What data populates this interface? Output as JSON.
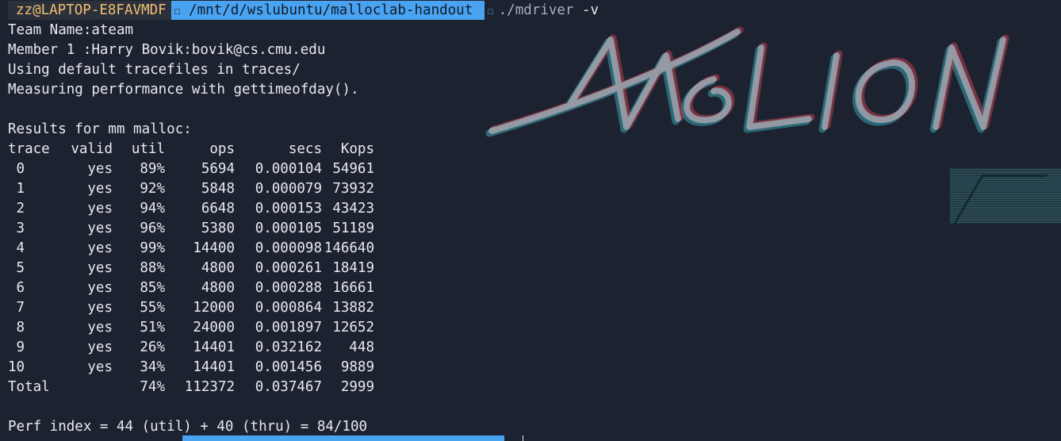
{
  "prompt": {
    "user_host": "zz@LAPTOP-E8FAVMDF",
    "path_glyph": "☐",
    "path": "/mnt/d/wslubuntu/malloclab-handout",
    "sep_glyph": "☐",
    "command": "./mdriver",
    "argument": "-v"
  },
  "header_lines": [
    "Team Name:ateam",
    "Member 1 :Harry Bovik:bovik@cs.cmu.edu",
    "Using default tracefiles in traces/",
    "Measuring performance with gettimeofday().",
    "",
    "Results for mm malloc:"
  ],
  "table": {
    "columns": [
      "trace",
      "valid",
      "util",
      "ops",
      "secs",
      "Kops"
    ],
    "rows": [
      {
        "trace": " 0",
        "valid": "yes",
        "util": "89%",
        "ops": "5694",
        "secs": "0.000104",
        "kops": "54961"
      },
      {
        "trace": " 1",
        "valid": "yes",
        "util": "92%",
        "ops": "5848",
        "secs": "0.000079",
        "kops": "73932"
      },
      {
        "trace": " 2",
        "valid": "yes",
        "util": "94%",
        "ops": "6648",
        "secs": "0.000153",
        "kops": "43423"
      },
      {
        "trace": " 3",
        "valid": "yes",
        "util": "96%",
        "ops": "5380",
        "secs": "0.000105",
        "kops": "51189"
      },
      {
        "trace": " 4",
        "valid": "yes",
        "util": "99%",
        "ops": "14400",
        "secs": "0.000098",
        "kops": "146640"
      },
      {
        "trace": " 5",
        "valid": "yes",
        "util": "88%",
        "ops": "4800",
        "secs": "0.000261",
        "kops": "18419"
      },
      {
        "trace": " 6",
        "valid": "yes",
        "util": "85%",
        "ops": "4800",
        "secs": "0.000288",
        "kops": "16661"
      },
      {
        "trace": " 7",
        "valid": "yes",
        "util": "55%",
        "ops": "12000",
        "secs": "0.000864",
        "kops": "13882"
      },
      {
        "trace": " 8",
        "valid": "yes",
        "util": "51%",
        "ops": "24000",
        "secs": "0.001897",
        "kops": "12652"
      },
      {
        "trace": " 9",
        "valid": "yes",
        "util": "26%",
        "ops": "14401",
        "secs": "0.032162",
        "kops": "448"
      },
      {
        "trace": "10",
        "valid": "yes",
        "util": "34%",
        "ops": "14401",
        "secs": "0.001456",
        "kops": "9889"
      }
    ],
    "total": {
      "trace": "Total",
      "valid": "",
      "util": "74%",
      "ops": "112372",
      "secs": "0.037467",
      "kops": "2999"
    }
  },
  "perf_index": "Perf index = 44 (util) + 40 (thru) = 84/100",
  "wallpaper_logo_text": "EVANGELION",
  "colors": {
    "background": "#1d2230",
    "path_segment": "#4aa3f0",
    "user_segment_text": "#f0c070",
    "text": "#e8eaf0"
  }
}
